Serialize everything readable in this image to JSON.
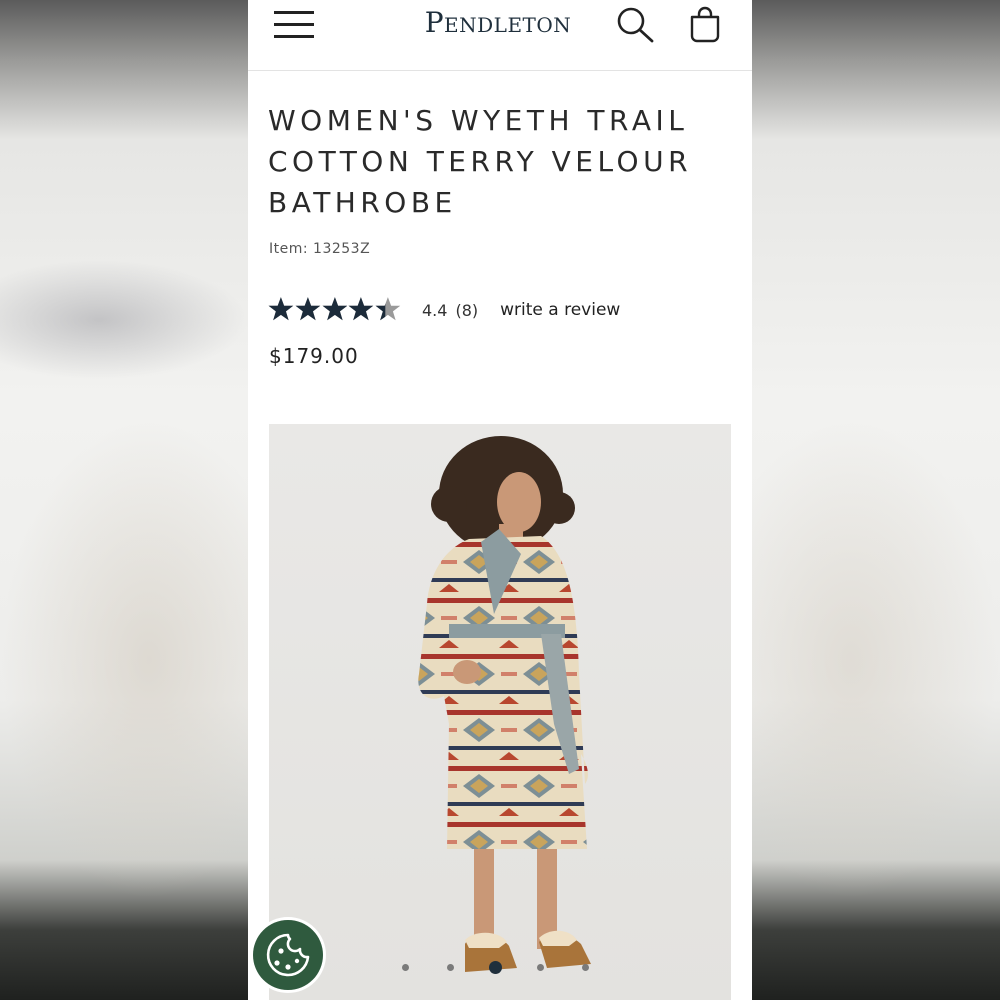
{
  "header": {
    "brand": "Pendleton"
  },
  "product": {
    "title": "WOMEN'S WYETH TRAIL COTTON TERRY VELOUR BATHROBE",
    "item_number": "Item: 13253Z",
    "rating_value": "4.4",
    "rating_stars": 4.4,
    "review_count": "(8)",
    "write_review": "write a review",
    "price": "$179.00"
  },
  "carousel": {
    "slide_count": 5,
    "active_index": 2
  },
  "colors": {
    "brand_navy": "#1f2f3c",
    "star_fill": "#1c2b3a",
    "star_empty": "#9a9a9a",
    "cookie_green": "#2f5a3e"
  },
  "icons": {
    "menu": "hamburger-menu-icon",
    "search": "search-icon",
    "bag": "shopping-bag-icon",
    "cookie": "cookie-icon"
  }
}
